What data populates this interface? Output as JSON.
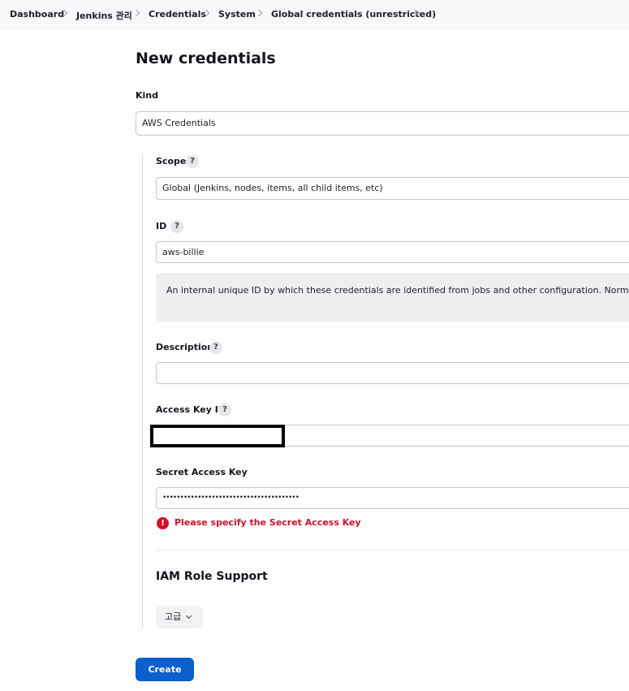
{
  "breadcrumb": {
    "items": [
      {
        "label": "Dashboard"
      },
      {
        "label": "Jenkins 관리"
      },
      {
        "label": "Credentials"
      },
      {
        "label": "System"
      },
      {
        "label": "Global credentials (unrestricted)"
      }
    ]
  },
  "page_title": "New credentials",
  "kind": {
    "label": "Kind",
    "value": "AWS Credentials"
  },
  "scope": {
    "label": "Scope",
    "help": "?",
    "value": "Global (Jenkins, nodes, items, all child items, etc)"
  },
  "id_field": {
    "label": "ID",
    "help": "?",
    "value": "aws-billie",
    "help_text": "An internal unique ID by which these credentials are identified from jobs and other configuration. Normally left b"
  },
  "description": {
    "label": "Description",
    "help": "?",
    "value": ""
  },
  "access_key_id": {
    "label": "Access Key ID",
    "help": "?",
    "value": ""
  },
  "secret_access_key": {
    "label": "Secret Access Key",
    "value": "•••••••••••••••••••••••••••••••••••••••",
    "error_icon": "!",
    "error": "Please specify the Secret Access Key"
  },
  "iam_role": {
    "heading": "IAM Role Support",
    "advanced_label": "고급"
  },
  "create_label": "Create",
  "colors": {
    "primary": "#0b5fcf",
    "error": "#d2112a",
    "breadcrumb_bg": "#f8f8fa"
  },
  "icons": [
    "chevron-right-icon",
    "help-icon",
    "error-icon",
    "chevron-down-icon"
  ]
}
